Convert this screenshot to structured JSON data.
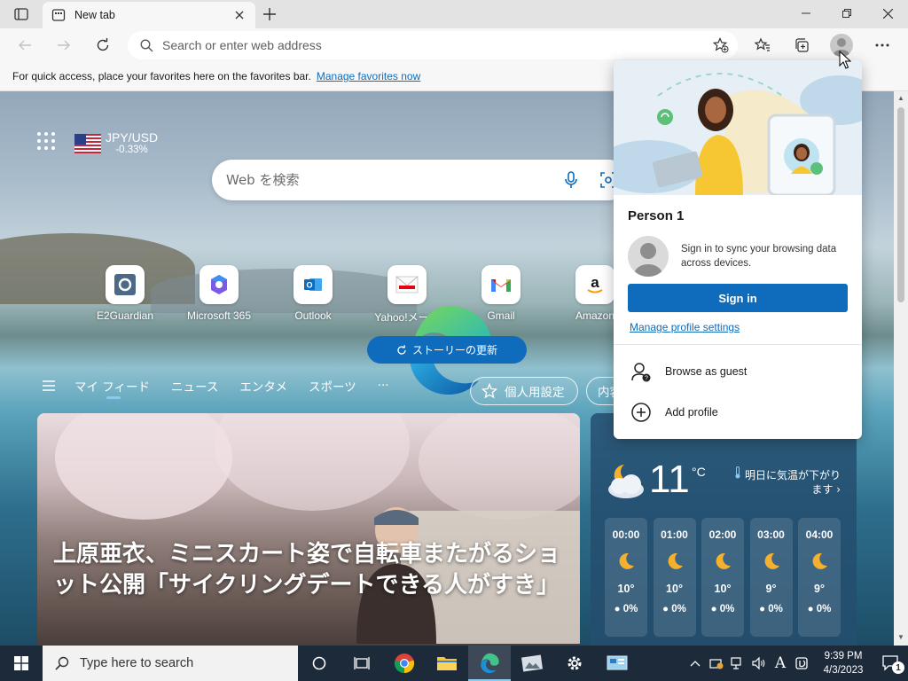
{
  "browser": {
    "tab": {
      "title": "New tab"
    },
    "address": {
      "placeholder": "Search or enter web address"
    },
    "favorites_bar": {
      "message": "For quick access, place your favorites here on the favorites bar.",
      "link": "Manage favorites now"
    }
  },
  "newtab": {
    "currency": {
      "pair": "JPY/USD",
      "change": "-0.33%"
    },
    "search": {
      "placeholder": "Web を検索"
    },
    "quick_links": [
      {
        "label": "E2Guardian",
        "icon": "e2guardian-icon"
      },
      {
        "label": "Microsoft 365",
        "icon": "microsoft365-icon"
      },
      {
        "label": "Outlook",
        "icon": "outlook-icon"
      },
      {
        "label": "Yahoo!メール",
        "icon": "yahoo-mail-icon"
      },
      {
        "label": "Gmail",
        "icon": "gmail-icon"
      },
      {
        "label": "Amazon",
        "icon": "amazon-icon"
      }
    ],
    "feed_nav": {
      "items": [
        "マイ フィード",
        "ニュース",
        "エンタメ",
        "スポーツ"
      ],
      "more": "···"
    },
    "personalize_label": "個人用設定",
    "content_label": "内容",
    "refresh_label": "ストーリーの更新",
    "headline": "上原亜衣、ミニスカート姿で自転車またがるショット公開「サイクリングデートできる人がすき」",
    "weather": {
      "temperature": "11",
      "unit": "°C",
      "message": "明日に気温が下がります",
      "hourly": [
        {
          "time": "00:00",
          "temp": "10°",
          "precip": "0%"
        },
        {
          "time": "01:00",
          "temp": "10°",
          "precip": "0%"
        },
        {
          "time": "02:00",
          "temp": "10°",
          "precip": "0%"
        },
        {
          "time": "03:00",
          "temp": "9°",
          "precip": "0%"
        },
        {
          "time": "04:00",
          "temp": "9°",
          "precip": "0%"
        }
      ]
    }
  },
  "profile_flyout": {
    "name": "Person 1",
    "sync_text": "Sign in to sync your browsing data across devices.",
    "sign_in": "Sign in",
    "manage": "Manage profile settings",
    "guest": "Browse as guest",
    "add_profile": "Add profile"
  },
  "taskbar": {
    "search_placeholder": "Type here to search",
    "time": "9:39 PM",
    "date": "4/3/2023",
    "notification_count": "1"
  },
  "colors": {
    "accent": "#0f6cbd",
    "taskbar": "#1c2a3a"
  }
}
